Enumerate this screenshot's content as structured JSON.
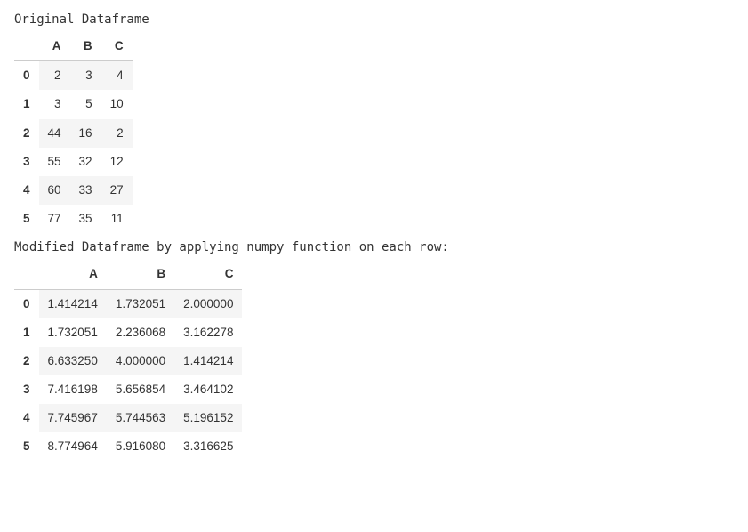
{
  "caption1": "Original Dataframe",
  "caption2": "Modified Dataframe by applying numpy function on each row:",
  "table1": {
    "columns": [
      "A",
      "B",
      "C"
    ],
    "index": [
      "0",
      "1",
      "2",
      "3",
      "4",
      "5"
    ],
    "rows": [
      [
        "2",
        "3",
        "4"
      ],
      [
        "3",
        "5",
        "10"
      ],
      [
        "44",
        "16",
        "2"
      ],
      [
        "55",
        "32",
        "12"
      ],
      [
        "60",
        "33",
        "27"
      ],
      [
        "77",
        "35",
        "11"
      ]
    ]
  },
  "table2": {
    "columns": [
      "A",
      "B",
      "C"
    ],
    "index": [
      "0",
      "1",
      "2",
      "3",
      "4",
      "5"
    ],
    "rows": [
      [
        "1.414214",
        "1.732051",
        "2.000000"
      ],
      [
        "1.732051",
        "2.236068",
        "3.162278"
      ],
      [
        "6.633250",
        "4.000000",
        "1.414214"
      ],
      [
        "7.416198",
        "5.656854",
        "3.464102"
      ],
      [
        "7.745967",
        "5.744563",
        "5.196152"
      ],
      [
        "8.774964",
        "5.916080",
        "3.316625"
      ]
    ]
  },
  "chart_data": [
    {
      "type": "table",
      "title": "Original Dataframe",
      "columns": [
        "A",
        "B",
        "C"
      ],
      "index": [
        0,
        1,
        2,
        3,
        4,
        5
      ],
      "data": [
        [
          2,
          3,
          4
        ],
        [
          3,
          5,
          10
        ],
        [
          44,
          16,
          2
        ],
        [
          55,
          32,
          12
        ],
        [
          60,
          33,
          27
        ],
        [
          77,
          35,
          11
        ]
      ]
    },
    {
      "type": "table",
      "title": "Modified Dataframe by applying numpy function on each row:",
      "columns": [
        "A",
        "B",
        "C"
      ],
      "index": [
        0,
        1,
        2,
        3,
        4,
        5
      ],
      "data": [
        [
          1.414214,
          1.732051,
          2.0
        ],
        [
          1.732051,
          2.236068,
          3.162278
        ],
        [
          6.63325,
          4.0,
          1.414214
        ],
        [
          7.416198,
          5.656854,
          3.464102
        ],
        [
          7.745967,
          5.744563,
          5.196152
        ],
        [
          8.774964,
          5.91608,
          3.316625
        ]
      ]
    }
  ]
}
